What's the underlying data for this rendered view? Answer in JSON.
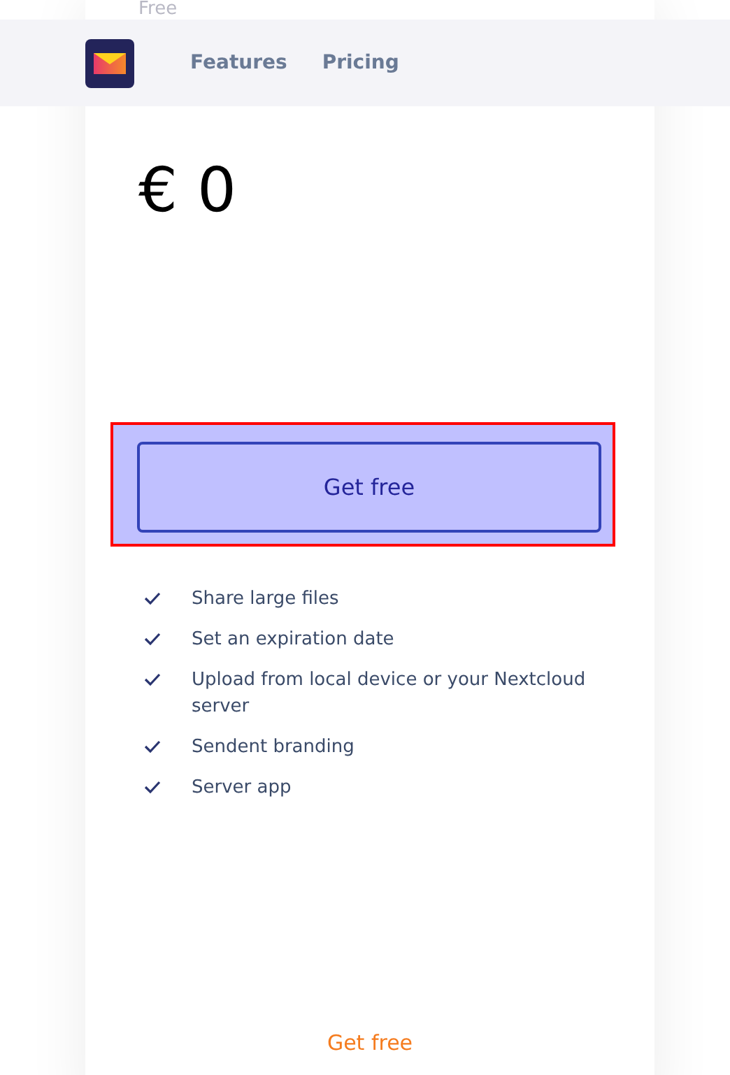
{
  "header": {
    "nav": [
      {
        "label": "Features"
      },
      {
        "label": "Pricing"
      }
    ]
  },
  "plan": {
    "title": "Free",
    "price": "€ 0",
    "highlighted": true,
    "button": "Get free",
    "features": [
      "Share large files",
      "Set an expiration date",
      "Upload from local device or your Nextcloud server",
      "Sendent branding",
      "Server app"
    ],
    "link": "Get free"
  }
}
